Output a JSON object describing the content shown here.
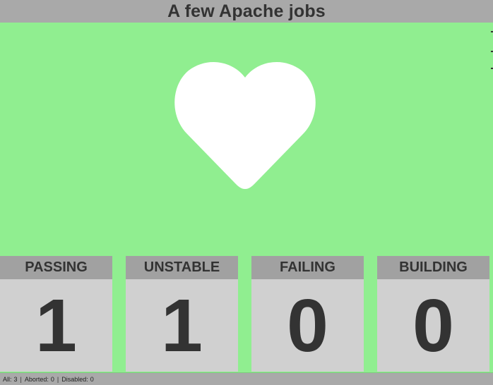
{
  "header": {
    "title": "A few Apache jobs"
  },
  "overall_status": {
    "icon": "heart-icon",
    "icon_color": "#FFFFFF",
    "background_color": "#90EE90"
  },
  "tiles": [
    {
      "label": "PASSING",
      "count": "1"
    },
    {
      "label": "UNSTABLE",
      "count": "1"
    },
    {
      "label": "FAILING",
      "count": "0"
    },
    {
      "label": "BUILDING",
      "count": "0"
    }
  ],
  "status_bar": {
    "all_label": "All:",
    "all_value": "3",
    "aborted_label": "Aborted:",
    "aborted_value": "0",
    "disabled_label": "Disabled:",
    "disabled_value": "0",
    "separator": "|"
  }
}
